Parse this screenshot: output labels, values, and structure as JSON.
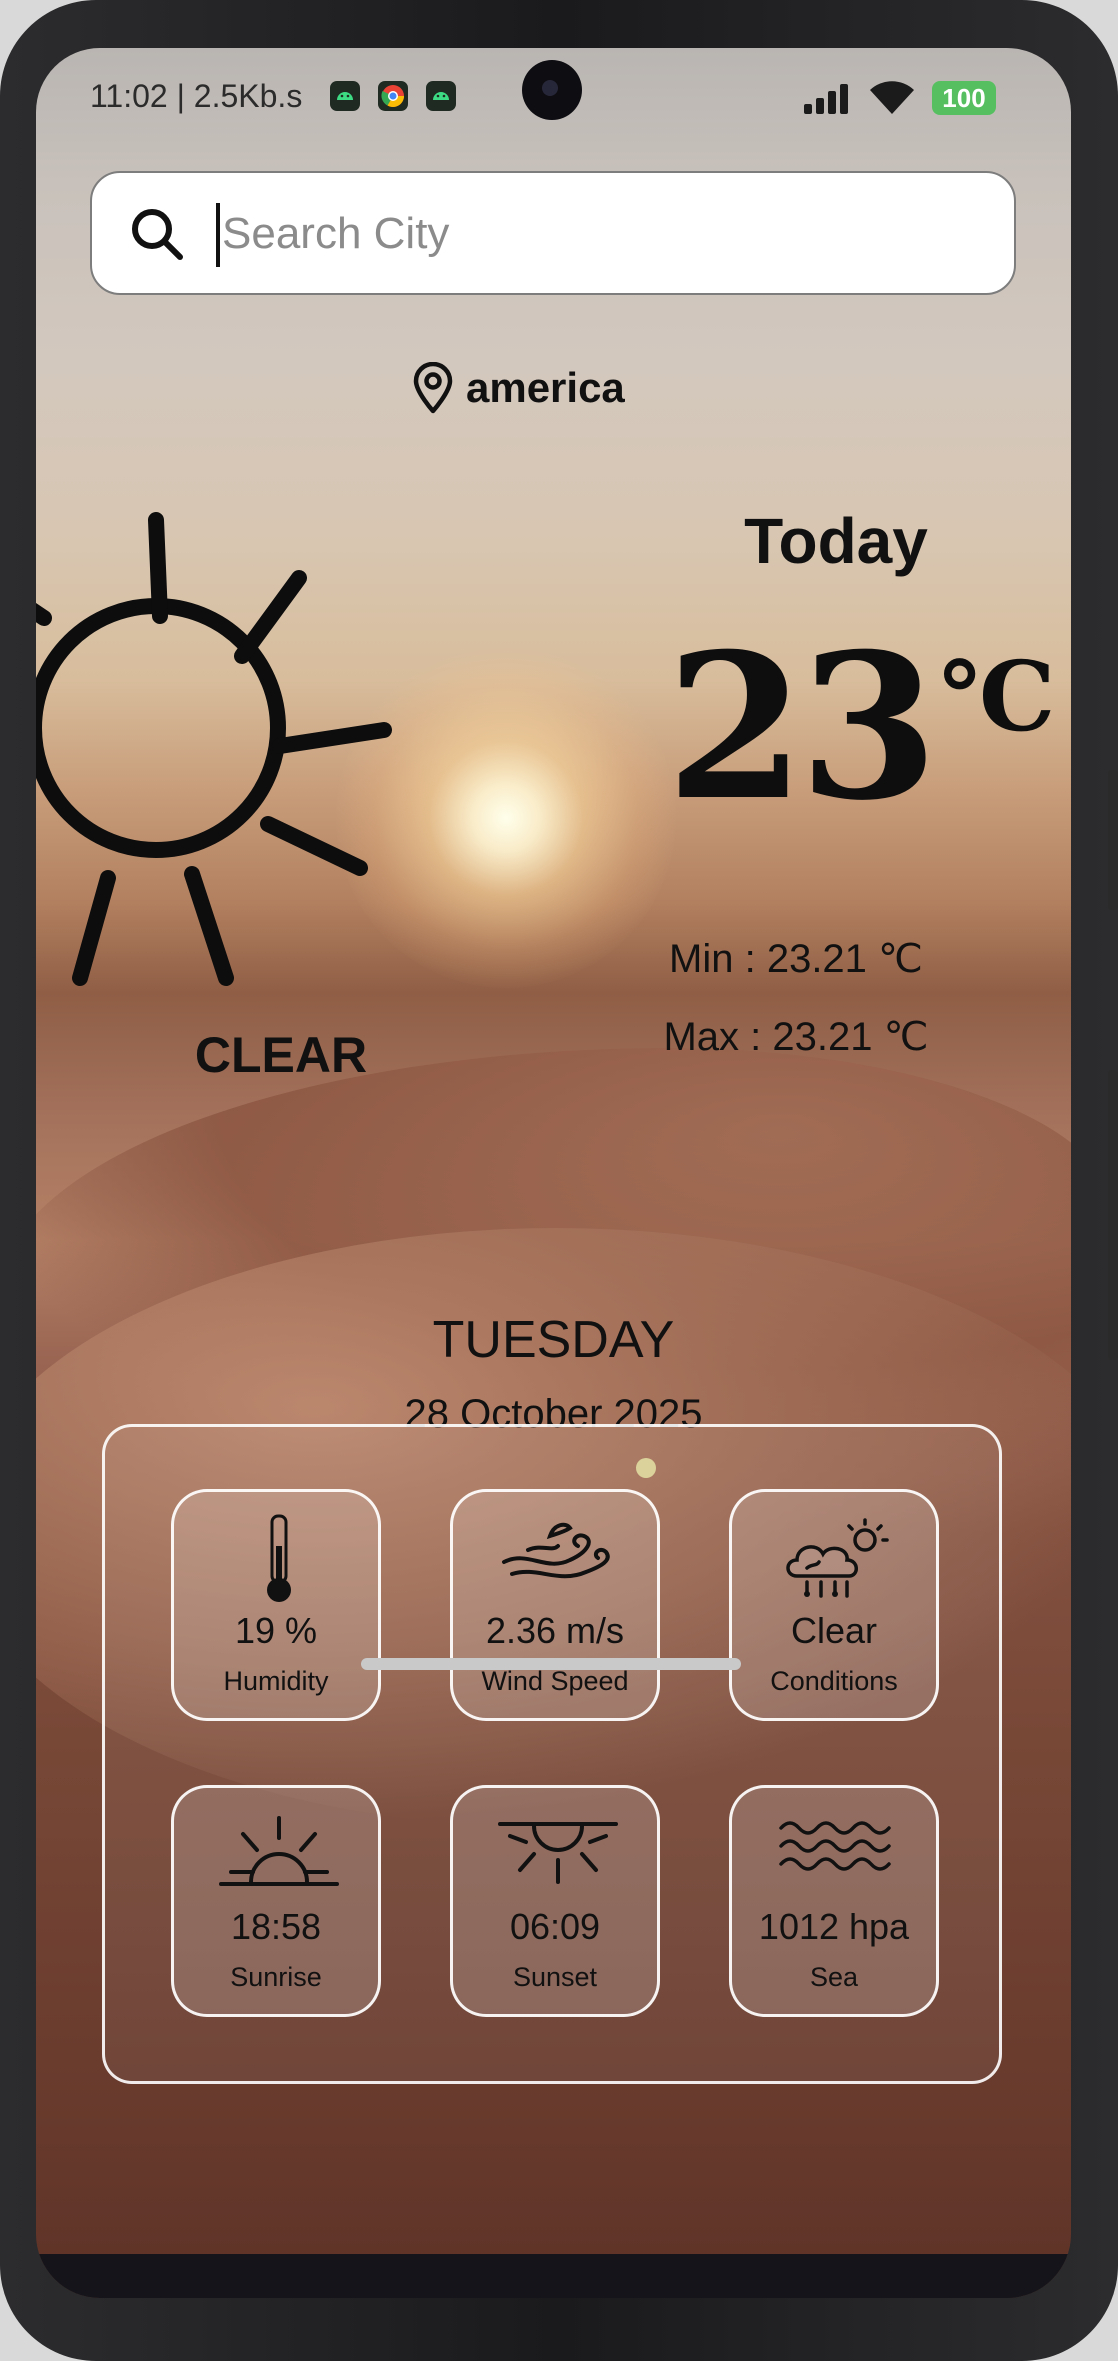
{
  "status_bar": {
    "time_speed": "11:02 | 2.5Kb.s",
    "battery": "100"
  },
  "search": {
    "placeholder": "Search City",
    "value": ""
  },
  "location": {
    "name": "america"
  },
  "weather": {
    "condition": "CLEAR",
    "today_label": "Today",
    "temperature": "23",
    "unit": "℃",
    "min": "Min : 23.21 ℃",
    "max": "Max : 23.21 ℃"
  },
  "date": {
    "day": "TUESDAY",
    "full": "28 October 2025"
  },
  "details": [
    {
      "icon": "thermometer-icon",
      "value": "19 %",
      "label": "Humidity"
    },
    {
      "icon": "wind-icon",
      "value": "2.36 m/s",
      "label": "Wind Speed"
    },
    {
      "icon": "cloud-sun-rain-icon",
      "value": "Clear",
      "label": "Conditions"
    },
    {
      "icon": "sunrise-icon",
      "value": "18:58",
      "label": "Sunrise"
    },
    {
      "icon": "sunset-icon",
      "value": "06:09",
      "label": "Sunset"
    },
    {
      "icon": "waves-icon",
      "value": "1012 hpa",
      "label": "Sea"
    }
  ],
  "colors": {
    "battery": "#56c060",
    "text": "#111111"
  }
}
